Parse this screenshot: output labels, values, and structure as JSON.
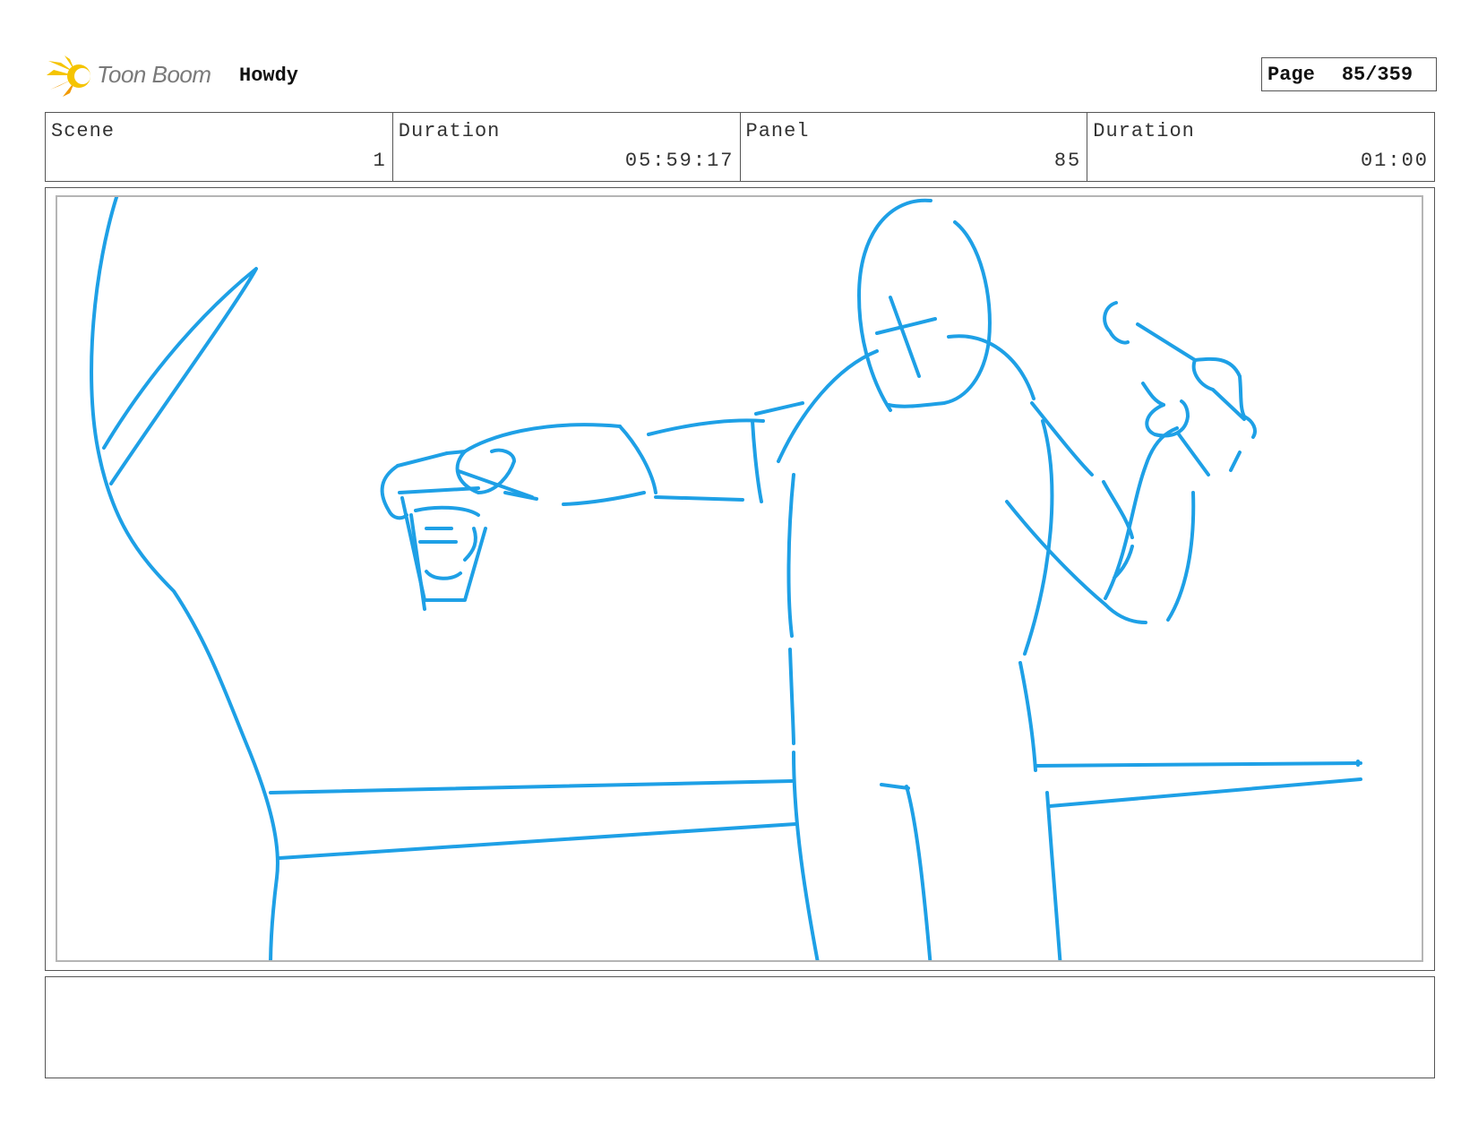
{
  "header": {
    "logo_text": "Toon Boom",
    "project_title": "Howdy",
    "page_label": "Page",
    "page_value": "85/359"
  },
  "info": {
    "scene_label": "Scene",
    "scene_value": "1",
    "scene_duration_label": "Duration",
    "scene_duration_value": "05:59:17",
    "panel_label": "Panel",
    "panel_value": "85",
    "panel_duration_label": "Duration",
    "panel_duration_value": "01:00"
  },
  "colors": {
    "sketch_stroke": "#1ea0e6",
    "logo_yellow": "#f5c400",
    "logo_orange": "#f29a00"
  },
  "notes": {
    "text": ""
  }
}
